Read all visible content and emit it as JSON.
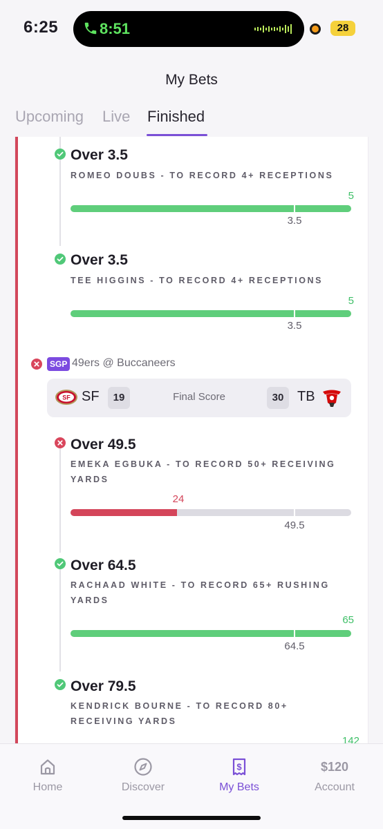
{
  "status_bar": {
    "time": "6:25",
    "call_time": "8:51",
    "battery": "28"
  },
  "header": {
    "title": "My Bets"
  },
  "tabs": [
    {
      "label": "Upcoming",
      "active": false
    },
    {
      "label": "Live",
      "active": false
    },
    {
      "label": "Finished",
      "active": true
    }
  ],
  "legs_top": [
    {
      "status": "win",
      "line": "Over 3.5",
      "description": "ROMEO DOUBS - TO RECORD 4+ RECEPTIONS",
      "actual": "5",
      "threshold": "3.5",
      "progress_fraction": 1.0
    },
    {
      "status": "win",
      "line": "Over 3.5",
      "description": "TEE HIGGINS - TO RECORD 4+ RECEPTIONS",
      "actual": "5",
      "threshold": "3.5",
      "progress_fraction": 1.0
    }
  ],
  "sgp": {
    "status": "loss",
    "badge": "SGP",
    "matchup": "49ers @ Buccaneers",
    "score": {
      "away_abbr": "SF",
      "away_score": "19",
      "label": "Final Score",
      "home_score": "30",
      "home_abbr": "TB"
    },
    "legs": [
      {
        "status": "loss",
        "line": "Over 49.5",
        "description": "EMEKA EGBUKA - TO RECORD 50+ RECEIVING YARDS",
        "actual": "24",
        "threshold": "49.5",
        "progress_fraction": 0.38
      },
      {
        "status": "win",
        "line": "Over 64.5",
        "description": "RACHAAD WHITE - TO RECORD 65+ RUSHING YARDS",
        "actual": "65",
        "threshold": "64.5",
        "progress_fraction": 1.0
      },
      {
        "status": "win",
        "line": "Over 79.5",
        "description": "KENDRICK BOURNE - TO RECORD 80+ RECEIVING YARDS",
        "actual": "142",
        "threshold": "",
        "progress_fraction": 1.0
      }
    ]
  },
  "colors": {
    "accent": "#7a4fd6",
    "win": "#5fce7b",
    "loss": "#d4455a"
  },
  "bottom_nav": {
    "home": "Home",
    "discover": "Discover",
    "my_bets": "My Bets",
    "account_balance": "$120",
    "account": "Account"
  }
}
